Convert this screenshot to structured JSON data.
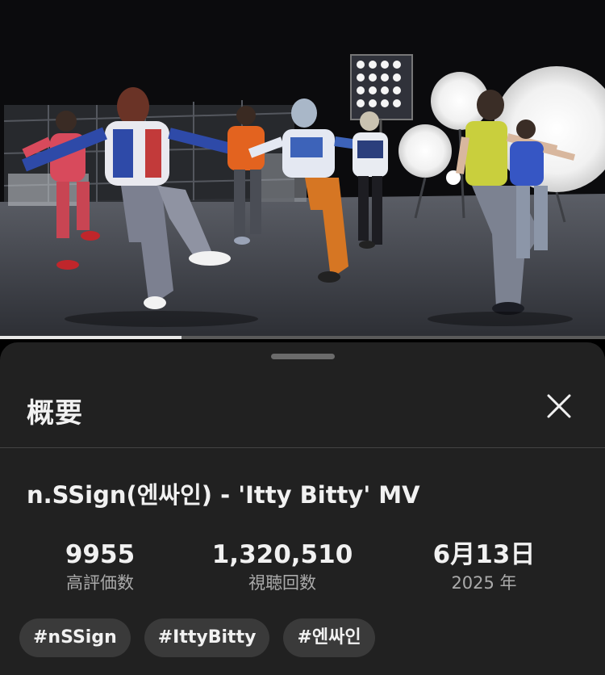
{
  "video": {
    "progress_fraction": 0.3
  },
  "panel": {
    "title": "概要",
    "close_icon": "close-icon"
  },
  "video_info": {
    "title": "n.SSign(엔싸인) - 'Itty Bitty' MV"
  },
  "stats": {
    "likes": {
      "value": "9955",
      "label": "高評価数"
    },
    "views": {
      "value": "1,320,510",
      "label": "視聴回数"
    },
    "date": {
      "value": "6月13日",
      "label": "2025 年"
    }
  },
  "hashtags": [
    "#nSSign",
    "#IttyBitty",
    "#엔싸인"
  ],
  "colors": {
    "panel_bg": "#212121",
    "chip_bg": "#3a3a3a",
    "text_primary": "#f1f1f1",
    "text_secondary": "#aaaaaa"
  }
}
